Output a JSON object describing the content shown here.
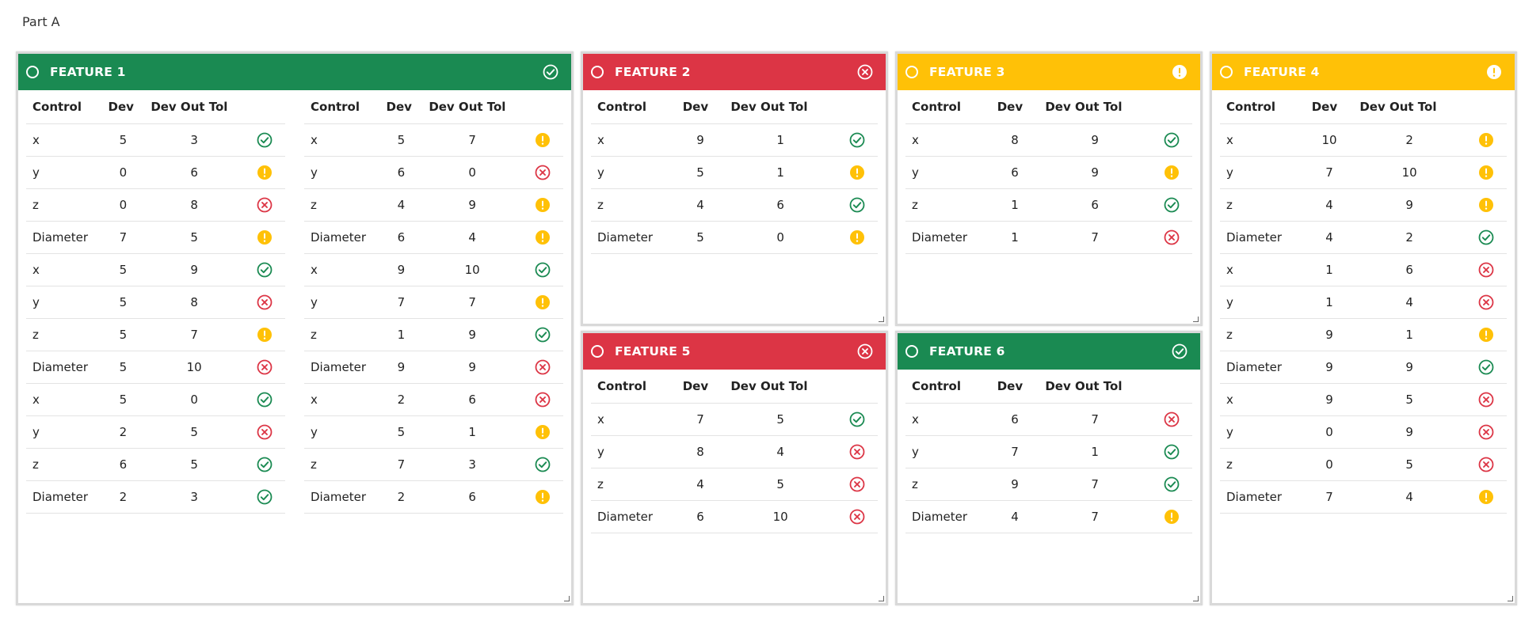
{
  "page": {
    "title": "Part A"
  },
  "colors": {
    "pass": "#1a8a52",
    "fail": "#dc3545",
    "warn": "#ffc107"
  },
  "headers": {
    "control": "Control",
    "dev": "Dev",
    "dev_out_tol": "Dev Out Tol"
  },
  "features": [
    {
      "title": "FEATURE 1",
      "status": "pass",
      "tables": [
        [
          {
            "control": "x",
            "dev": "5",
            "tol": "3",
            "status": "pass"
          },
          {
            "control": "y",
            "dev": "0",
            "tol": "6",
            "status": "warn"
          },
          {
            "control": "z",
            "dev": "0",
            "tol": "8",
            "status": "fail"
          },
          {
            "control": "Diameter",
            "dev": "7",
            "tol": "5",
            "status": "warn"
          },
          {
            "control": "x",
            "dev": "5",
            "tol": "9",
            "status": "pass"
          },
          {
            "control": "y",
            "dev": "5",
            "tol": "8",
            "status": "fail"
          },
          {
            "control": "z",
            "dev": "5",
            "tol": "7",
            "status": "warn"
          },
          {
            "control": "Diameter",
            "dev": "5",
            "tol": "10",
            "status": "fail"
          },
          {
            "control": "x",
            "dev": "5",
            "tol": "0",
            "status": "pass"
          },
          {
            "control": "y",
            "dev": "2",
            "tol": "5",
            "status": "fail"
          },
          {
            "control": "z",
            "dev": "6",
            "tol": "5",
            "status": "pass"
          },
          {
            "control": "Diameter",
            "dev": "2",
            "tol": "3",
            "status": "pass"
          }
        ],
        [
          {
            "control": "x",
            "dev": "5",
            "tol": "7",
            "status": "warn"
          },
          {
            "control": "y",
            "dev": "6",
            "tol": "0",
            "status": "fail"
          },
          {
            "control": "z",
            "dev": "4",
            "tol": "9",
            "status": "warn"
          },
          {
            "control": "Diameter",
            "dev": "6",
            "tol": "4",
            "status": "warn"
          },
          {
            "control": "x",
            "dev": "9",
            "tol": "10",
            "status": "pass"
          },
          {
            "control": "y",
            "dev": "7",
            "tol": "7",
            "status": "warn"
          },
          {
            "control": "z",
            "dev": "1",
            "tol": "9",
            "status": "pass"
          },
          {
            "control": "Diameter",
            "dev": "9",
            "tol": "9",
            "status": "fail"
          },
          {
            "control": "x",
            "dev": "2",
            "tol": "6",
            "status": "fail"
          },
          {
            "control": "y",
            "dev": "5",
            "tol": "1",
            "status": "warn"
          },
          {
            "control": "z",
            "dev": "7",
            "tol": "3",
            "status": "pass"
          },
          {
            "control": "Diameter",
            "dev": "2",
            "tol": "6",
            "status": "warn"
          }
        ]
      ]
    },
    {
      "title": "FEATURE 2",
      "status": "fail",
      "tables": [
        [
          {
            "control": "x",
            "dev": "9",
            "tol": "1",
            "status": "pass"
          },
          {
            "control": "y",
            "dev": "5",
            "tol": "1",
            "status": "warn"
          },
          {
            "control": "z",
            "dev": "4",
            "tol": "6",
            "status": "pass"
          },
          {
            "control": "Diameter",
            "dev": "5",
            "tol": "0",
            "status": "warn"
          }
        ]
      ]
    },
    {
      "title": "FEATURE 3",
      "status": "warn",
      "tables": [
        [
          {
            "control": "x",
            "dev": "8",
            "tol": "9",
            "status": "pass"
          },
          {
            "control": "y",
            "dev": "6",
            "tol": "9",
            "status": "warn"
          },
          {
            "control": "z",
            "dev": "1",
            "tol": "6",
            "status": "pass"
          },
          {
            "control": "Diameter",
            "dev": "1",
            "tol": "7",
            "status": "fail"
          }
        ]
      ]
    },
    {
      "title": "FEATURE 4",
      "status": "warn",
      "tables": [
        [
          {
            "control": "x",
            "dev": "10",
            "tol": "2",
            "status": "warn"
          },
          {
            "control": "y",
            "dev": "7",
            "tol": "10",
            "status": "warn"
          },
          {
            "control": "z",
            "dev": "4",
            "tol": "9",
            "status": "warn"
          },
          {
            "control": "Diameter",
            "dev": "4",
            "tol": "2",
            "status": "pass"
          },
          {
            "control": "x",
            "dev": "1",
            "tol": "6",
            "status": "fail"
          },
          {
            "control": "y",
            "dev": "1",
            "tol": "4",
            "status": "fail"
          },
          {
            "control": "z",
            "dev": "9",
            "tol": "1",
            "status": "warn"
          },
          {
            "control": "Diameter",
            "dev": "9",
            "tol": "9",
            "status": "pass"
          },
          {
            "control": "x",
            "dev": "9",
            "tol": "5",
            "status": "fail"
          },
          {
            "control": "y",
            "dev": "0",
            "tol": "9",
            "status": "fail"
          },
          {
            "control": "z",
            "dev": "0",
            "tol": "5",
            "status": "fail"
          },
          {
            "control": "Diameter",
            "dev": "7",
            "tol": "4",
            "status": "warn"
          }
        ]
      ]
    },
    {
      "title": "FEATURE 5",
      "status": "fail",
      "tables": [
        [
          {
            "control": "x",
            "dev": "7",
            "tol": "5",
            "status": "pass"
          },
          {
            "control": "y",
            "dev": "8",
            "tol": "4",
            "status": "fail"
          },
          {
            "control": "z",
            "dev": "4",
            "tol": "5",
            "status": "fail"
          },
          {
            "control": "Diameter",
            "dev": "6",
            "tol": "10",
            "status": "fail"
          }
        ]
      ]
    },
    {
      "title": "FEATURE 6",
      "status": "pass",
      "tables": [
        [
          {
            "control": "x",
            "dev": "6",
            "tol": "7",
            "status": "fail"
          },
          {
            "control": "y",
            "dev": "7",
            "tol": "1",
            "status": "pass"
          },
          {
            "control": "z",
            "dev": "9",
            "tol": "7",
            "status": "pass"
          },
          {
            "control": "Diameter",
            "dev": "4",
            "tol": "7",
            "status": "warn"
          }
        ]
      ]
    }
  ]
}
